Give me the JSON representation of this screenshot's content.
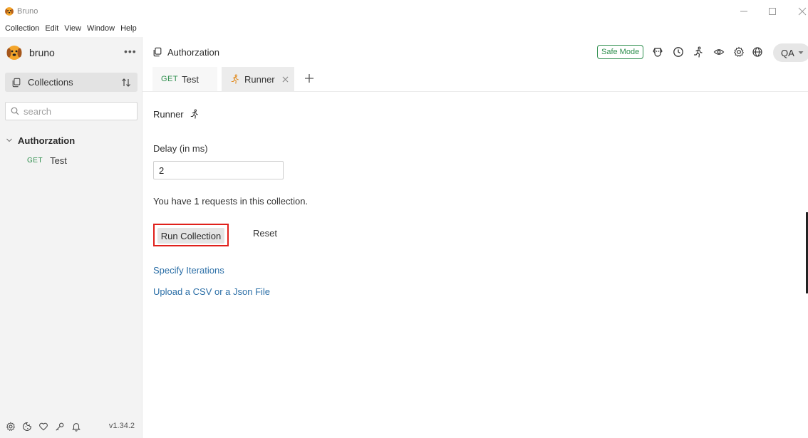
{
  "window": {
    "title": "Bruno",
    "menu": [
      "Collection",
      "Edit",
      "View",
      "Window",
      "Help"
    ]
  },
  "sidebar": {
    "brand": "bruno",
    "more_glyph": "•••",
    "collections_label": "Collections",
    "search_placeholder": "search",
    "collection_name": "Authorzation",
    "requests": [
      {
        "method": "GET",
        "name": "Test"
      }
    ],
    "version": "v1.34.2"
  },
  "header": {
    "collection_name": "Authorzation",
    "safe_mode_label": "Safe Mode",
    "environment": "QA"
  },
  "tabs": [
    {
      "method": "GET",
      "label": "Test"
    },
    {
      "label": "Runner"
    }
  ],
  "runner": {
    "title": "Runner",
    "delay_label": "Delay (in ms)",
    "delay_value": "2",
    "count_prefix": "You have",
    "count": "1",
    "count_suffix": "requests in this collection.",
    "run_button": "Run Collection",
    "reset_button": "Reset",
    "specify_iterations": "Specify Iterations",
    "upload_file": "Upload a CSV or a Json File"
  },
  "icons": {
    "app": "bruno-dog-icon",
    "collections": "collection-copy-icon",
    "sort": "sort-arrows-icon",
    "search": "search-icon",
    "runner": "running-person-icon",
    "header": [
      "dog-icon",
      "history-clock-icon",
      "runner-icon",
      "eye-icon",
      "gear-icon",
      "globe-icon"
    ],
    "footer": [
      "gear-icon",
      "cookie-icon",
      "heart-icon",
      "key-icon",
      "bell-icon"
    ]
  },
  "colors": {
    "accent_green": "#2f8f4e",
    "link_blue": "#2c6fa7",
    "highlight_red": "#e0201b",
    "sidebar_bg": "#f3f3f3"
  }
}
